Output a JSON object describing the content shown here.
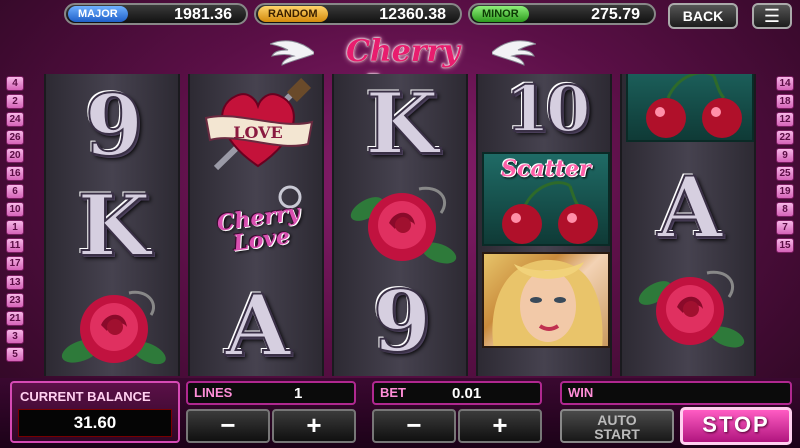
{
  "jackpots": {
    "major": {
      "label": "MAJOR",
      "value": "1981.36"
    },
    "random": {
      "label": "RANDOM",
      "value": "12360.38"
    },
    "minor": {
      "label": "MINOR",
      "value": "275.79"
    }
  },
  "nav": {
    "back_label": "BACK",
    "menu_icon": "hamburger-icon"
  },
  "logo": {
    "text": "Cherry Love"
  },
  "line_numbers": {
    "left": [
      "4",
      "2",
      "24",
      "26",
      "20",
      "16",
      "6",
      "10",
      "1",
      "11",
      "17",
      "13",
      "23",
      "21",
      "3",
      "5"
    ],
    "right": [
      "14",
      "18",
      "12",
      "22",
      "9",
      "25",
      "19",
      "8",
      "7",
      "15"
    ]
  },
  "reels": [
    {
      "symbols": [
        "9",
        "K",
        "rose"
      ]
    },
    {
      "symbols": [
        "heart-love",
        "cherry-love-charm",
        "A"
      ]
    },
    {
      "symbols": [
        "K",
        "rose",
        "9"
      ]
    },
    {
      "symbols": [
        "10",
        "scatter",
        "woman"
      ]
    },
    {
      "symbols": [
        "cherries",
        "A",
        "rose"
      ]
    }
  ],
  "symbol_text": {
    "love": "LOVE",
    "cherry_love": "Cherry Love",
    "scatter": "Scatter"
  },
  "controls": {
    "balance_label": "CURRENT BALANCE",
    "balance_value": "31.60",
    "lines_label": "LINES",
    "lines_value": "1",
    "bet_label": "BET",
    "bet_value": "0.01",
    "win_label": "WIN",
    "minus": "−",
    "plus": "+",
    "auto_start_line1": "AUTO",
    "auto_start_line2": "START",
    "stop_label": "STOP"
  },
  "colors": {
    "accent": "#e81d6e",
    "panel_border": "#b02890",
    "background": "#5a0f46"
  }
}
